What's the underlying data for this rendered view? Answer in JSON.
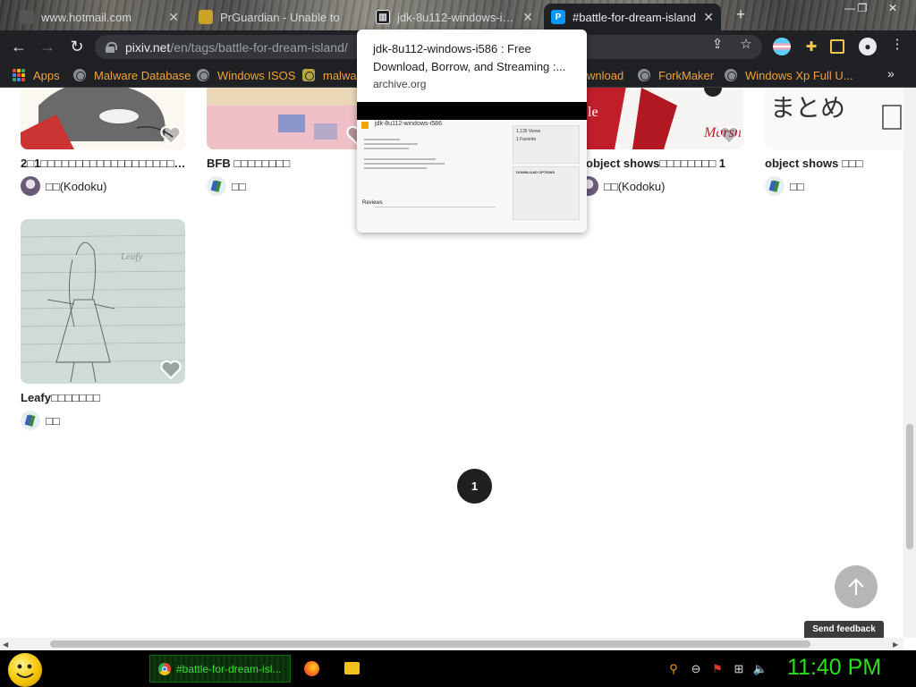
{
  "browser": {
    "tabs": [
      {
        "title": "www.hotmail.com",
        "active": false
      },
      {
        "title": "PrGuardian - Unable to",
        "active": false
      },
      {
        "title": "jdk-8u112-windows-i586",
        "active": false
      },
      {
        "title": "#battle-for-dream-island",
        "active": true
      }
    ],
    "new_tab": "+",
    "url_host": "pixiv.net",
    "url_path": "/en/tags/battle-for-dream-island/"
  },
  "bookmarks": [
    {
      "label": "Apps",
      "icon": "apps-grid-icon"
    },
    {
      "label": "Malware Database",
      "icon": "globe-icon"
    },
    {
      "label": "Windows ISOS",
      "icon": "globe-icon"
    },
    {
      "label": "malwa",
      "icon": "person-icon"
    },
    {
      "label": "wnload",
      "icon": "globe-icon"
    },
    {
      "label": "ForkMaker",
      "icon": "globe-icon"
    },
    {
      "label": "Windows Xp Full U...",
      "icon": "globe-icon"
    }
  ],
  "bookmarks_more": "»",
  "tab_preview": {
    "title": "jdk-8u112-windows-i586 : Free Download, Borrow, and Streaming :...",
    "domain": "archive.org",
    "shot_heading": "jdk-8u112-windows-i586",
    "shot_views": "1,135 Views",
    "shot_favorite": "1 Favorite",
    "shot_download": "DOWNLOAD OPTIONS",
    "shot_reviews": "Reviews"
  },
  "artworks": [
    {
      "title": "2□1□□□□□□□□□□□□□□□□□□□□□□□□□□...",
      "author": "□□(Kodoku)",
      "avatar_color": "#6a5a78"
    },
    {
      "title": "BFB □□□□□□□□",
      "author": "□□",
      "avatar_color": "#3a8a3a"
    },
    {
      "title": "object shows□□□□□□□□ 1",
      "author": "□□(Kodoku)",
      "avatar_color": "#6a5a78"
    },
    {
      "title": "object shows □□□",
      "author": "□□",
      "avatar_color": "#3a8a3a"
    },
    {
      "title": "Leafy□□□□□□□",
      "author": "□□",
      "avatar_color": "#3a8a3a"
    }
  ],
  "pagination": {
    "current": "1"
  },
  "feedback_label": "Send feedback",
  "taskbar": {
    "chrome_task": "#battle-for-dream-isl...",
    "clock": "11:40 PM"
  },
  "colors": {
    "bookmark_text": "#f0a23a",
    "clock": "#27e21c",
    "chrome_bg": "#202124"
  }
}
